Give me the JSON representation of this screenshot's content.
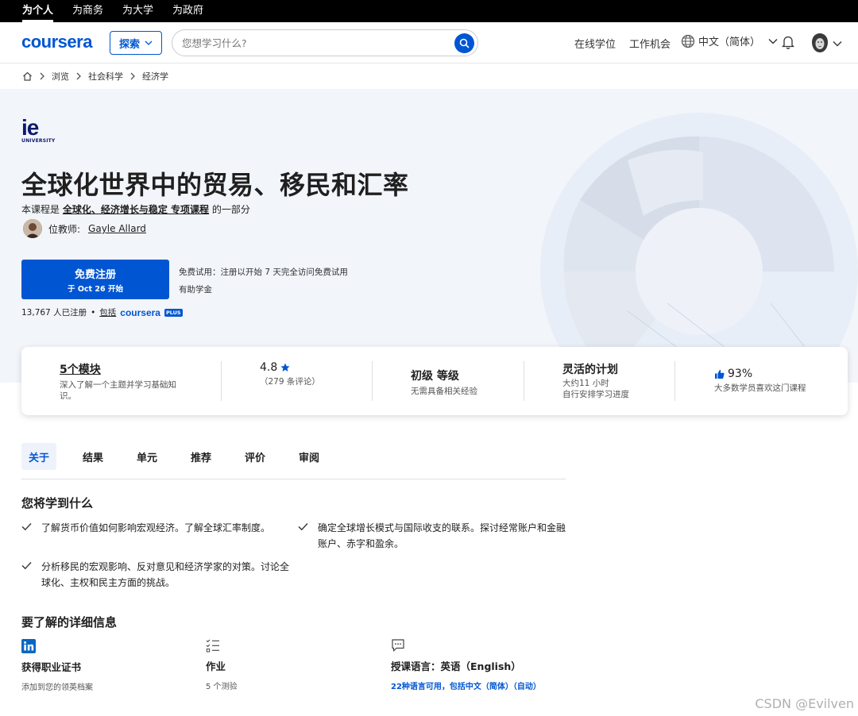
{
  "topbar": {
    "tabs": [
      "为个人",
      "为商务",
      "为大学",
      "为政府"
    ]
  },
  "header": {
    "logo": "coursera",
    "explore_label": "探索",
    "search_placeholder": "您想学习什么?",
    "nav": [
      "在线学位",
      "工作机会"
    ],
    "language": "中文（简体）"
  },
  "breadcrumb": [
    "浏览",
    "社会科学",
    "经济学"
  ],
  "hero": {
    "university_logo": "ie",
    "university_sub": "UNIVERSITY",
    "title": "全球化世界中的贸易、移民和汇率",
    "sub_prefix": "本课程是",
    "sub_link": "全球化、经济增长与稳定 专项课程",
    "sub_suffix": "的一部分",
    "instructor_label": "位教师:",
    "instructor_name": "Gayle Allard",
    "enroll_line1": "免费注册",
    "enroll_line2": "于 Oct 26 开始",
    "trial": "免费试用：注册以开始 7 天完全访问免费试用",
    "aid": "有助学金",
    "enrolled_count": "13,767 人已注册",
    "bullet": "•",
    "includes": "包括",
    "brand": "coursera",
    "plus": "PLUS"
  },
  "stats": [
    {
      "heading": "5个模块",
      "sub": "深入了解一个主题并学习基础知识。"
    },
    {
      "heading": "4.8",
      "sub": "（279 条评论）"
    },
    {
      "heading": "初级 等级",
      "sub": "无需具备相关经验"
    },
    {
      "heading": "灵活的计划",
      "sub": "大约11 小时",
      "sub2": "自行安排学习进度"
    },
    {
      "heading": "93%",
      "sub": "大多数学员喜欢这门课程"
    }
  ],
  "tabs": [
    "关于",
    "结果",
    "单元",
    "推荐",
    "评价",
    "审阅"
  ],
  "learn": {
    "title": "您将学到什么",
    "items": [
      "了解货币价值如何影响宏观经济。了解全球汇率制度。",
      "确定全球增长模式与国际收支的联系。探讨经常账户和金融账户、赤字和盈余。",
      "分析移民的宏观影响、反对意见和经济学家的对策。讨论全球化、主权和民主方面的挑战。"
    ]
  },
  "details": {
    "title": "要了解的详细信息",
    "items": [
      {
        "heading": "获得职业证书",
        "sub": "添加到您的领英档案"
      },
      {
        "heading": "作业",
        "sub": "5 个测验"
      },
      {
        "heading": "授课语言：英语（English）",
        "sub": "22种语言可用，包括中文（简体）（自动）"
      }
    ]
  },
  "watermark": "CSDN @Evilven",
  "colors": {
    "brand": "#0056d2",
    "hero_bg": "#f2f5fa"
  }
}
